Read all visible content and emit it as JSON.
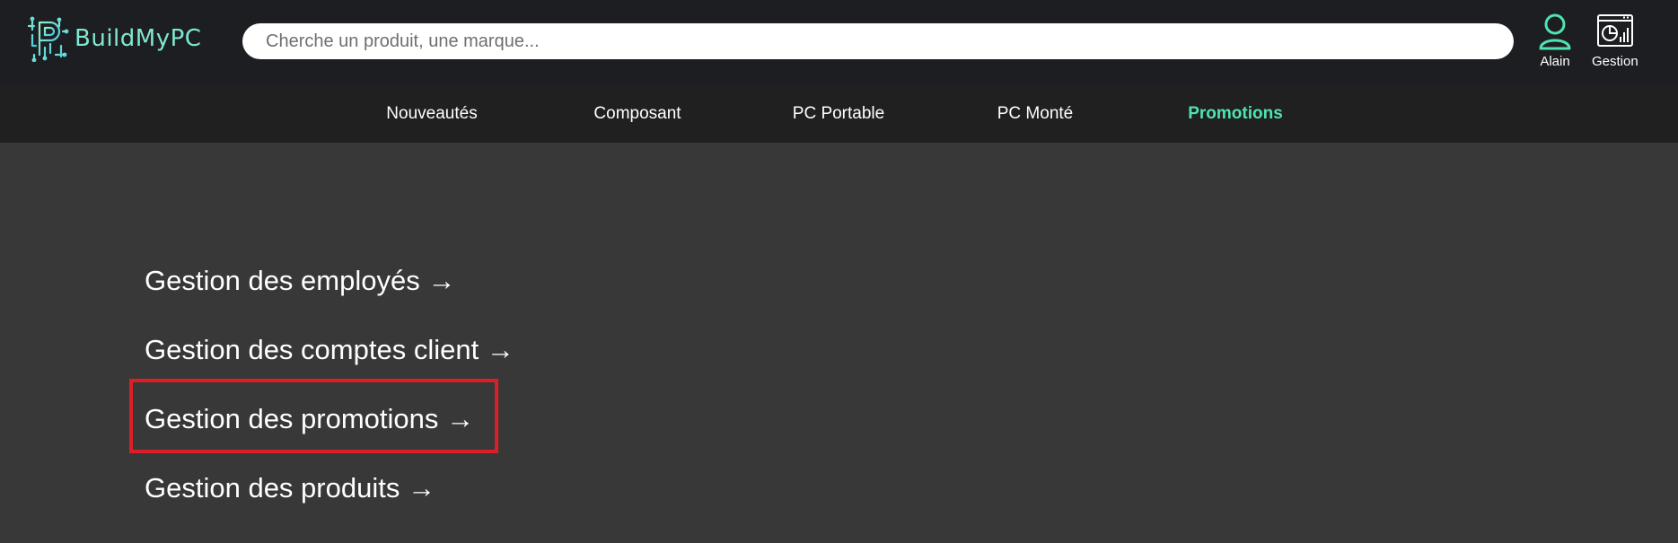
{
  "brand": {
    "name": "BuildMyPC",
    "accent": "#7fe8d2",
    "icon": "circuit-logo-icon"
  },
  "search": {
    "placeholder": "Cherche un produit, une marque...",
    "value": ""
  },
  "header_actions": [
    {
      "label": "Alain",
      "icon": "user-icon",
      "color": "#4fe3b2"
    },
    {
      "label": "Gestion",
      "icon": "dashboard-icon",
      "color": "#ffffff"
    }
  ],
  "nav": {
    "items": [
      {
        "label": "Nouveautés",
        "active": false
      },
      {
        "label": "Composant",
        "active": false
      },
      {
        "label": "PC Portable",
        "active": false
      },
      {
        "label": "PC Monté",
        "active": false
      },
      {
        "label": "Promotions",
        "active": true
      }
    ],
    "active_color": "#4fe3b2"
  },
  "menu": {
    "links": [
      {
        "label": "Gestion des employés →"
      },
      {
        "label": "Gestion des comptes client →"
      },
      {
        "label": "Gestion des promotions →"
      },
      {
        "label": "Gestion des produits →"
      }
    ],
    "highlight_color": "#dc1f26"
  }
}
